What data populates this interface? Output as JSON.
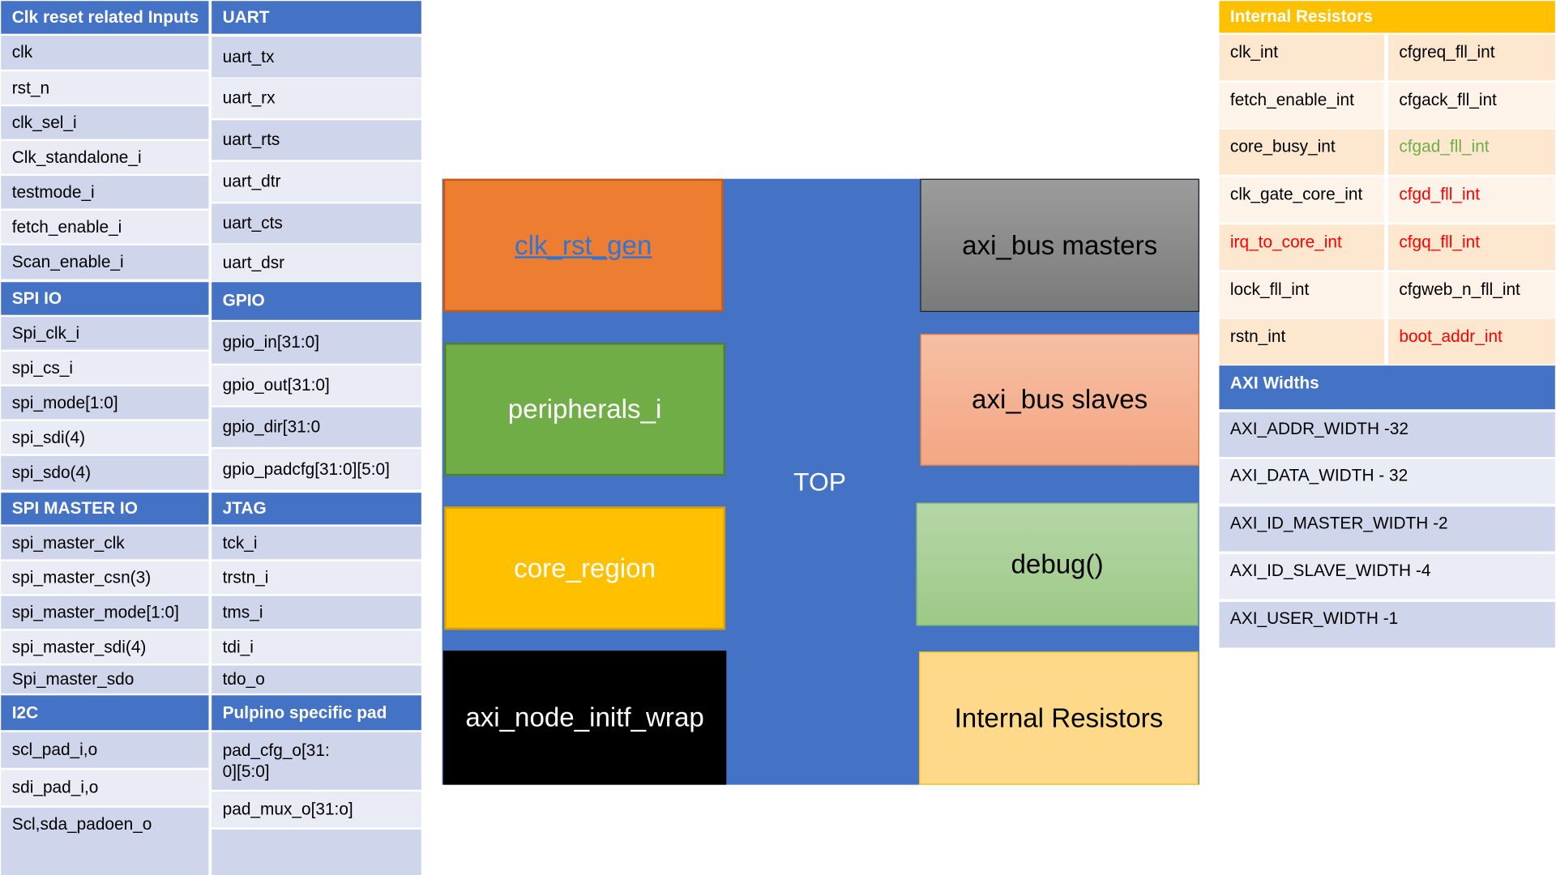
{
  "left_tables": {
    "clk_reset": {
      "header": "Clk reset related Inputs",
      "items": [
        "clk",
        "rst_n",
        "clk_sel_i",
        "Clk_standalone_i",
        "testmode_i",
        "fetch_enable_i",
        "Scan_enable_i"
      ]
    },
    "uart": {
      "header": "UART",
      "items": [
        "uart_tx",
        "uart_rx",
        "uart_rts",
        "uart_dtr",
        "uart_cts",
        "uart_dsr"
      ]
    },
    "spi_io": {
      "header": "SPI IO",
      "items": [
        "Spi_clk_i",
        "spi_cs_i",
        "spi_mode[1:0]",
        "spi_sdi(4)",
        "spi_sdo(4)"
      ]
    },
    "gpio": {
      "header": "GPIO",
      "items": [
        "gpio_in[31:0]",
        "gpio_out[31:0]",
        "gpio_dir[31:0",
        "gpio_padcfg[31:0][5:0]"
      ]
    },
    "spi_master": {
      "header": "SPI MASTER IO",
      "items": [
        "spi_master_clk",
        "spi_master_csn(3)",
        "spi_master_mode[1:0]",
        "spi_master_sdi(4)",
        "Spi_master_sdo"
      ]
    },
    "jtag": {
      "header": "JTAG",
      "items": [
        "tck_i",
        "trstn_i",
        "tms_i",
        "tdi_i",
        "tdo_o"
      ]
    },
    "i2c": {
      "header": "I2C",
      "items": [
        "scl_pad_i,o",
        "sdi_pad_i,o",
        "Scl,sda_padoen_o"
      ]
    },
    "pulpino": {
      "header": "Pulpino specific pad",
      "items": [
        "pad_cfg_o[31:\n0][5:0]",
        "pad_mux_o[31:o]",
        ""
      ]
    }
  },
  "center": {
    "top_label": "TOP",
    "blocks": {
      "clk_rst_gen": {
        "label": "clk_rst_gen",
        "color": "#ed7d31"
      },
      "peripherals": {
        "label": "peripherals_i",
        "color": "#70ad47"
      },
      "core_region": {
        "label": "core_region",
        "color": "#ffc000"
      },
      "axi_node": {
        "label": "axi_node_initf_wrap",
        "color": "#000000"
      },
      "axi_masters": {
        "label": "axi_bus masters",
        "color": "#8c8c8c"
      },
      "axi_slaves": {
        "label": "axi_bus slaves",
        "color": "#f4b183"
      },
      "debug": {
        "label": "debug()",
        "color": "#a9d18e"
      },
      "internal_resistors": {
        "label": "Internal Resistors",
        "color": "#ffd98a"
      }
    }
  },
  "internal_resistors": {
    "header": "Internal Resistors",
    "rows": [
      [
        {
          "text": "clk_int",
          "color": "#000000"
        },
        {
          "text": "cfgreq_fll_int",
          "color": "#000000"
        }
      ],
      [
        {
          "text": "fetch_enable_int",
          "color": "#000000"
        },
        {
          "text": "cfgack_fll_int",
          "color": "#000000"
        }
      ],
      [
        {
          "text": "core_busy_int",
          "color": "#000000"
        },
        {
          "text": "cfgad_fll_int",
          "color": "#70ad47"
        }
      ],
      [
        {
          "text": "clk_gate_core_int",
          "color": "#000000"
        },
        {
          "text": "cfgd_fll_int",
          "color": "#ff0000"
        }
      ],
      [
        {
          "text": "irq_to_core_int",
          "color": "#ff0000"
        },
        {
          "text": "cfgq_fll_int",
          "color": "#ff0000"
        }
      ],
      [
        {
          "text": "lock_fll_int",
          "color": "#000000"
        },
        {
          "text": "cfgweb_n_fll_int",
          "color": "#000000"
        }
      ],
      [
        {
          "text": "rstn_int",
          "color": "#000000"
        },
        {
          "text": "boot_addr_int",
          "color": "#ff0000"
        }
      ]
    ]
  },
  "axi_widths": {
    "header": "AXI Widths",
    "items": [
      "AXI_ADDR_WIDTH -32",
      "AXI_DATA_WIDTH - 32",
      "AXI_ID_MASTER_WIDTH -2",
      "AXI_ID_SLAVE_WIDTH -4",
      "AXI_USER_WIDTH -1"
    ]
  }
}
